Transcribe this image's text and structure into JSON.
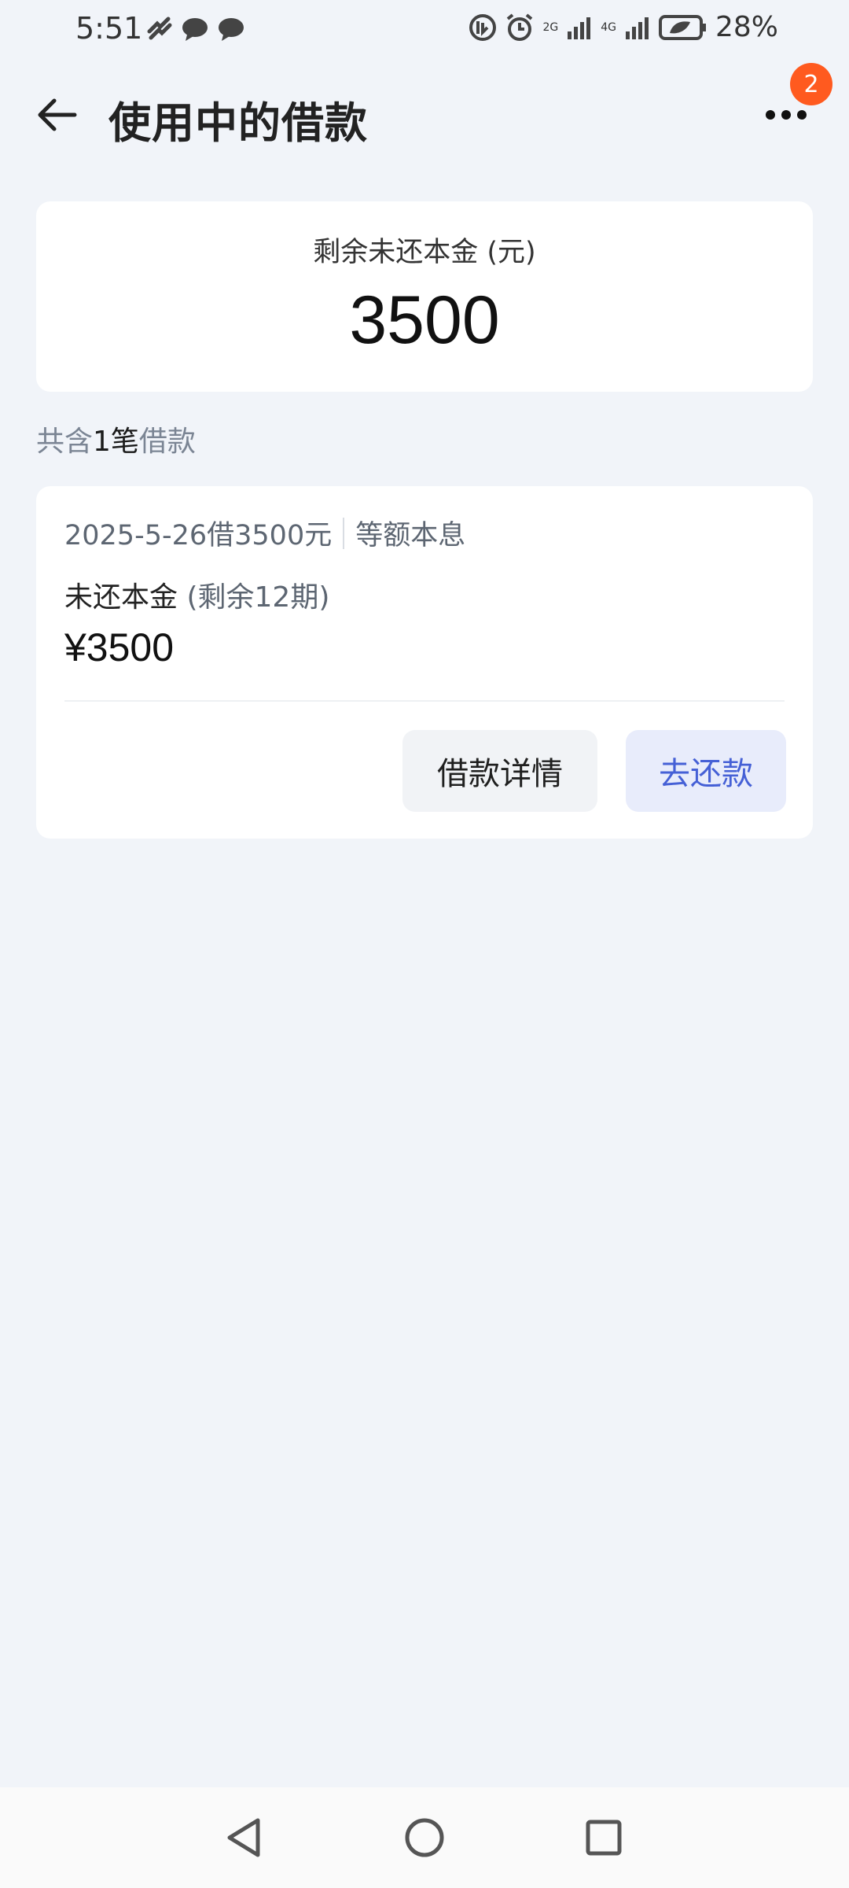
{
  "status_bar": {
    "time": "5:51",
    "battery": "28%",
    "net1": "2G",
    "net2": "4G"
  },
  "header": {
    "title": "使用中的借款",
    "badge_count": "2"
  },
  "summary": {
    "label": "剩余未还本金 (元)",
    "amount": "3500"
  },
  "count": {
    "prefix": "共含",
    "number": "1笔",
    "suffix": "借款"
  },
  "loan": {
    "date_amount": "2025-5-26借3500元",
    "repay_type": "等额本息",
    "principal_label": "未还本金",
    "remaining_periods": " (剩余12期)",
    "principal_amount": "¥3500",
    "detail_button": "借款详情",
    "repay_button": "去还款"
  },
  "colors": {
    "accent": "#4560d6",
    "badge": "#ff5a1f",
    "background": "#f1f4f9"
  }
}
